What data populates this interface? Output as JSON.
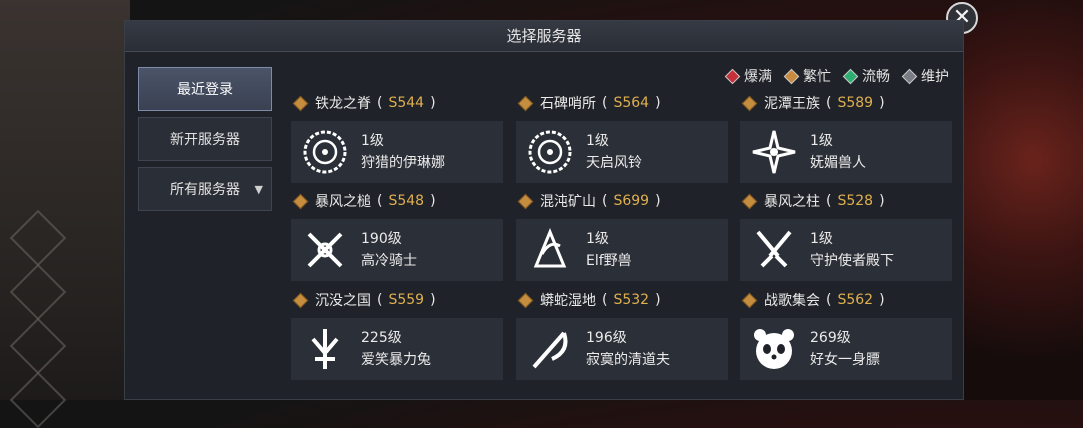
{
  "window": {
    "title": "选择服务器"
  },
  "tabs": [
    {
      "label": "最近登录",
      "active": true
    },
    {
      "label": "新开服务器",
      "active": false
    },
    {
      "label": "所有服务器",
      "active": false,
      "dropdown_icon": "triangle-down-icon"
    }
  ],
  "legend": [
    {
      "label": "爆满",
      "color": "#c4313a"
    },
    {
      "label": "繁忙",
      "color": "#c88a3c"
    },
    {
      "label": "流畅",
      "color": "#2fae72"
    },
    {
      "label": "维护",
      "color": "#777c85"
    }
  ],
  "servers": [
    {
      "name": "铁龙之脊",
      "code": "S544",
      "level": "1级",
      "character": "狩猎的伊琳娜",
      "avatar": "class-emblem-circle-icon"
    },
    {
      "name": "石碑哨所",
      "code": "S564",
      "level": "1级",
      "character": "天启风铃",
      "avatar": "class-emblem-circle-icon"
    },
    {
      "name": "泥潭王族",
      "code": "S589",
      "level": "1级",
      "character": "妩媚兽人",
      "avatar": "class-emblem-cross-icon"
    },
    {
      "name": "暴风之槌",
      "code": "S548",
      "level": "190级",
      "character": "高冷骑士",
      "avatar": "class-emblem-swords-icon"
    },
    {
      "name": "混沌矿山",
      "code": "S699",
      "level": "1级",
      "character": "Elf野兽",
      "avatar": "class-emblem-claw-icon"
    },
    {
      "name": "暴风之柱",
      "code": "S528",
      "level": "1级",
      "character": "守护使者殿下",
      "avatar": "class-emblem-daggers-icon"
    },
    {
      "name": "沉没之国",
      "code": "S559",
      "level": "225级",
      "character": "爱笑暴力兔",
      "avatar": "class-emblem-trident-icon"
    },
    {
      "name": "蟒蛇湿地",
      "code": "S532",
      "level": "196级",
      "character": "寂寞的清道夫",
      "avatar": "class-emblem-scythe-icon"
    },
    {
      "name": "战歌集会",
      "code": "S562",
      "level": "269级",
      "character": "好女一身膘",
      "avatar": "panda-face-icon"
    }
  ]
}
